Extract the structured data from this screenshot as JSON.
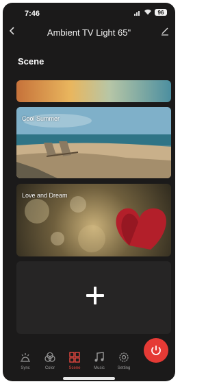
{
  "status_bar": {
    "time": "7:46",
    "battery": "96"
  },
  "header": {
    "title": "Ambient TV Light 65\""
  },
  "section": {
    "title": "Scene"
  },
  "scenes": [
    {
      "label": "Cool Summer"
    },
    {
      "label": "Love and Dream"
    }
  ],
  "nav": {
    "items": [
      {
        "label": "Sync",
        "icon": "sync-icon"
      },
      {
        "label": "Color",
        "icon": "color-icon"
      },
      {
        "label": "Scene",
        "icon": "scene-icon"
      },
      {
        "label": "Music",
        "icon": "music-icon"
      },
      {
        "label": "Setting",
        "icon": "setting-icon"
      }
    ],
    "active": "Scene"
  },
  "colors": {
    "accent": "#e5473f",
    "power": "#e53a35",
    "background": "#1b1a1a"
  }
}
